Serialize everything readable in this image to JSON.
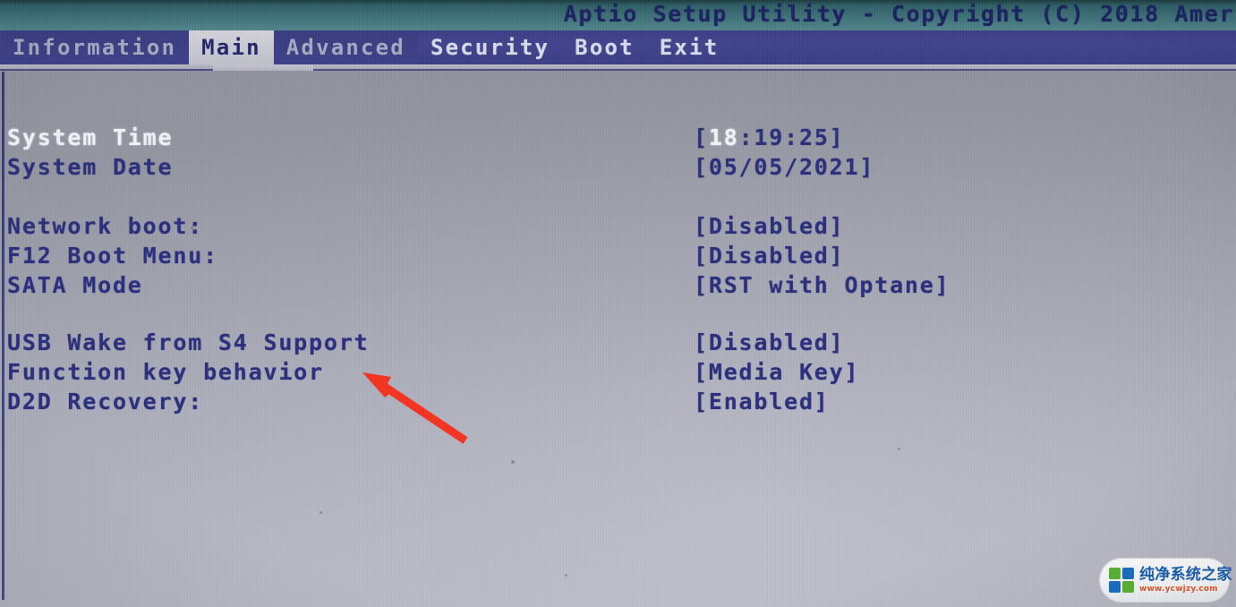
{
  "header": {
    "title": "Aptio Setup Utility - Copyright (C) 2018 Amer"
  },
  "menubar": {
    "tabs": [
      {
        "label": "Information",
        "state": "dim"
      },
      {
        "label": "Main",
        "state": "active"
      },
      {
        "label": "Advanced",
        "state": "normal"
      },
      {
        "label": "Security",
        "state": "normal"
      },
      {
        "label": "Boot",
        "state": "normal"
      },
      {
        "label": "Exit",
        "state": "normal"
      }
    ]
  },
  "main": {
    "rows": [
      {
        "label": "System Time",
        "value": "[18:19:25]",
        "cursor": "18",
        "selected": true
      },
      {
        "label": "System Date",
        "value": "[05/05/2021]",
        "selected": false
      },
      {
        "label": "Network boot:",
        "value": "[Disabled]",
        "selected": false
      },
      {
        "label": "F12 Boot Menu:",
        "value": "[Disabled]",
        "selected": false
      },
      {
        "label": "SATA Mode",
        "value": "[RST with Optane]",
        "selected": false
      },
      {
        "label": "USB Wake from S4 Support",
        "value": "[Disabled]",
        "selected": false
      },
      {
        "label": "Function key behavior",
        "value": "[Media Key]",
        "selected": false
      },
      {
        "label": "D2D Recovery:",
        "value": "[Enabled]",
        "selected": false
      }
    ]
  },
  "annotation": {
    "arrow_color": "#f63422",
    "target_row_label": "Function key behavior"
  },
  "watermark": {
    "title": "纯净系统之家",
    "url": "www.ycwjzy.com",
    "logo_colors": [
      "#5cb531",
      "#1a6fc4",
      "#1a6fc4",
      "#5cb531"
    ]
  },
  "colors": {
    "screen_bg": "#9a9ca8",
    "menubar_bg": "#3f4288",
    "topstrip_bg": "#3f7179",
    "text_blue": "#2a2e7d",
    "text_highlight": "#f2f3f8",
    "active_tab_bg": "#c9cad3"
  }
}
